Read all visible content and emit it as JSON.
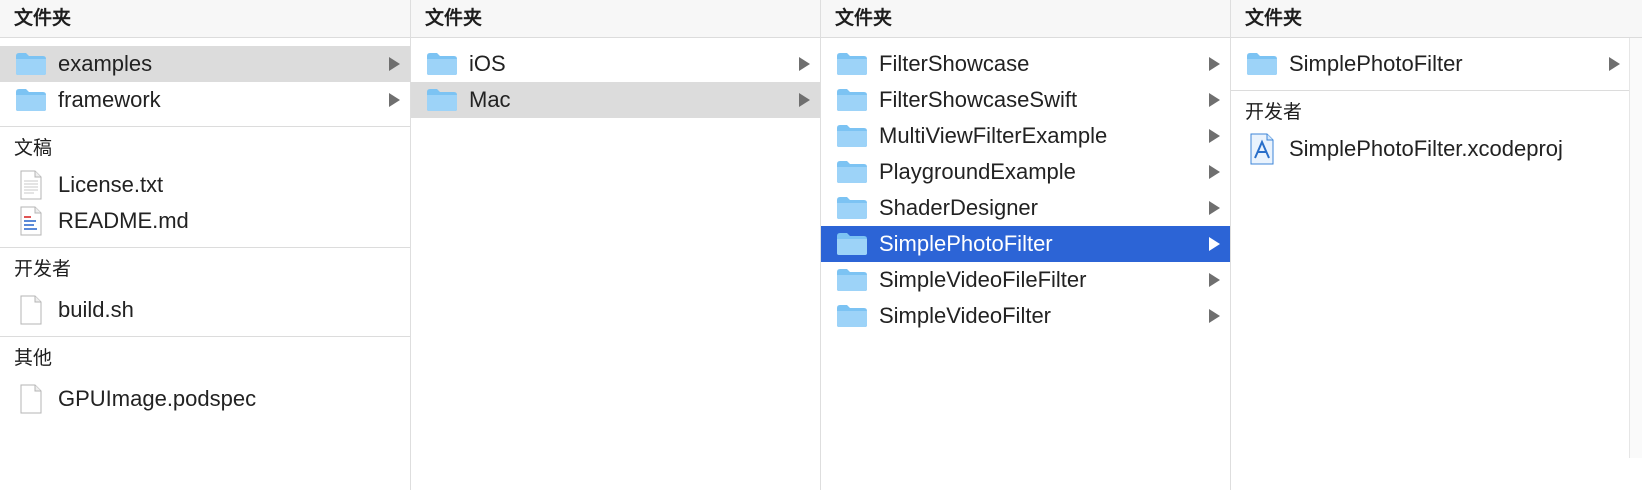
{
  "columns": [
    {
      "sections": [
        {
          "title": "文件夹",
          "items": [
            {
              "label": "examples",
              "icon": "folder-icon",
              "arrow": true,
              "selected": "gray"
            },
            {
              "label": "framework",
              "icon": "folder-icon",
              "arrow": true
            }
          ]
        },
        {
          "title": "文稿",
          "items": [
            {
              "label": "License.txt",
              "icon": "text-file-icon"
            },
            {
              "label": "README.md",
              "icon": "markdown-file-icon"
            }
          ]
        },
        {
          "title": "开发者",
          "items": [
            {
              "label": "build.sh",
              "icon": "blank-file-icon"
            }
          ]
        },
        {
          "title": "其他",
          "items": [
            {
              "label": "GPUImage.podspec",
              "icon": "blank-file-icon"
            }
          ]
        }
      ]
    },
    {
      "sections": [
        {
          "title": "文件夹",
          "items": [
            {
              "label": "iOS",
              "icon": "folder-icon",
              "arrow": true
            },
            {
              "label": "Mac",
              "icon": "folder-icon",
              "arrow": true,
              "selected": "gray"
            }
          ]
        }
      ]
    },
    {
      "sections": [
        {
          "title": "文件夹",
          "items": [
            {
              "label": "FilterShowcase",
              "icon": "folder-icon",
              "arrow": true
            },
            {
              "label": "FilterShowcaseSwift",
              "icon": "folder-icon",
              "arrow": true
            },
            {
              "label": "MultiViewFilterExample",
              "icon": "folder-icon",
              "arrow": true
            },
            {
              "label": "PlaygroundExample",
              "icon": "folder-icon",
              "arrow": true
            },
            {
              "label": "ShaderDesigner",
              "icon": "folder-icon",
              "arrow": true
            },
            {
              "label": "SimplePhotoFilter",
              "icon": "folder-icon",
              "arrow": true,
              "selected": "blue"
            },
            {
              "label": "SimpleVideoFileFilter",
              "icon": "folder-icon",
              "arrow": true
            },
            {
              "label": "SimpleVideoFilter",
              "icon": "folder-icon",
              "arrow": true
            }
          ]
        }
      ]
    },
    {
      "sections": [
        {
          "title": "文件夹",
          "items": [
            {
              "label": "SimplePhotoFilter",
              "icon": "folder-icon",
              "arrow": true
            }
          ]
        },
        {
          "title": "开发者",
          "items": [
            {
              "label": "SimplePhotoFilter.xcodeproj",
              "icon": "xcodeproj-icon"
            }
          ]
        }
      ]
    }
  ]
}
